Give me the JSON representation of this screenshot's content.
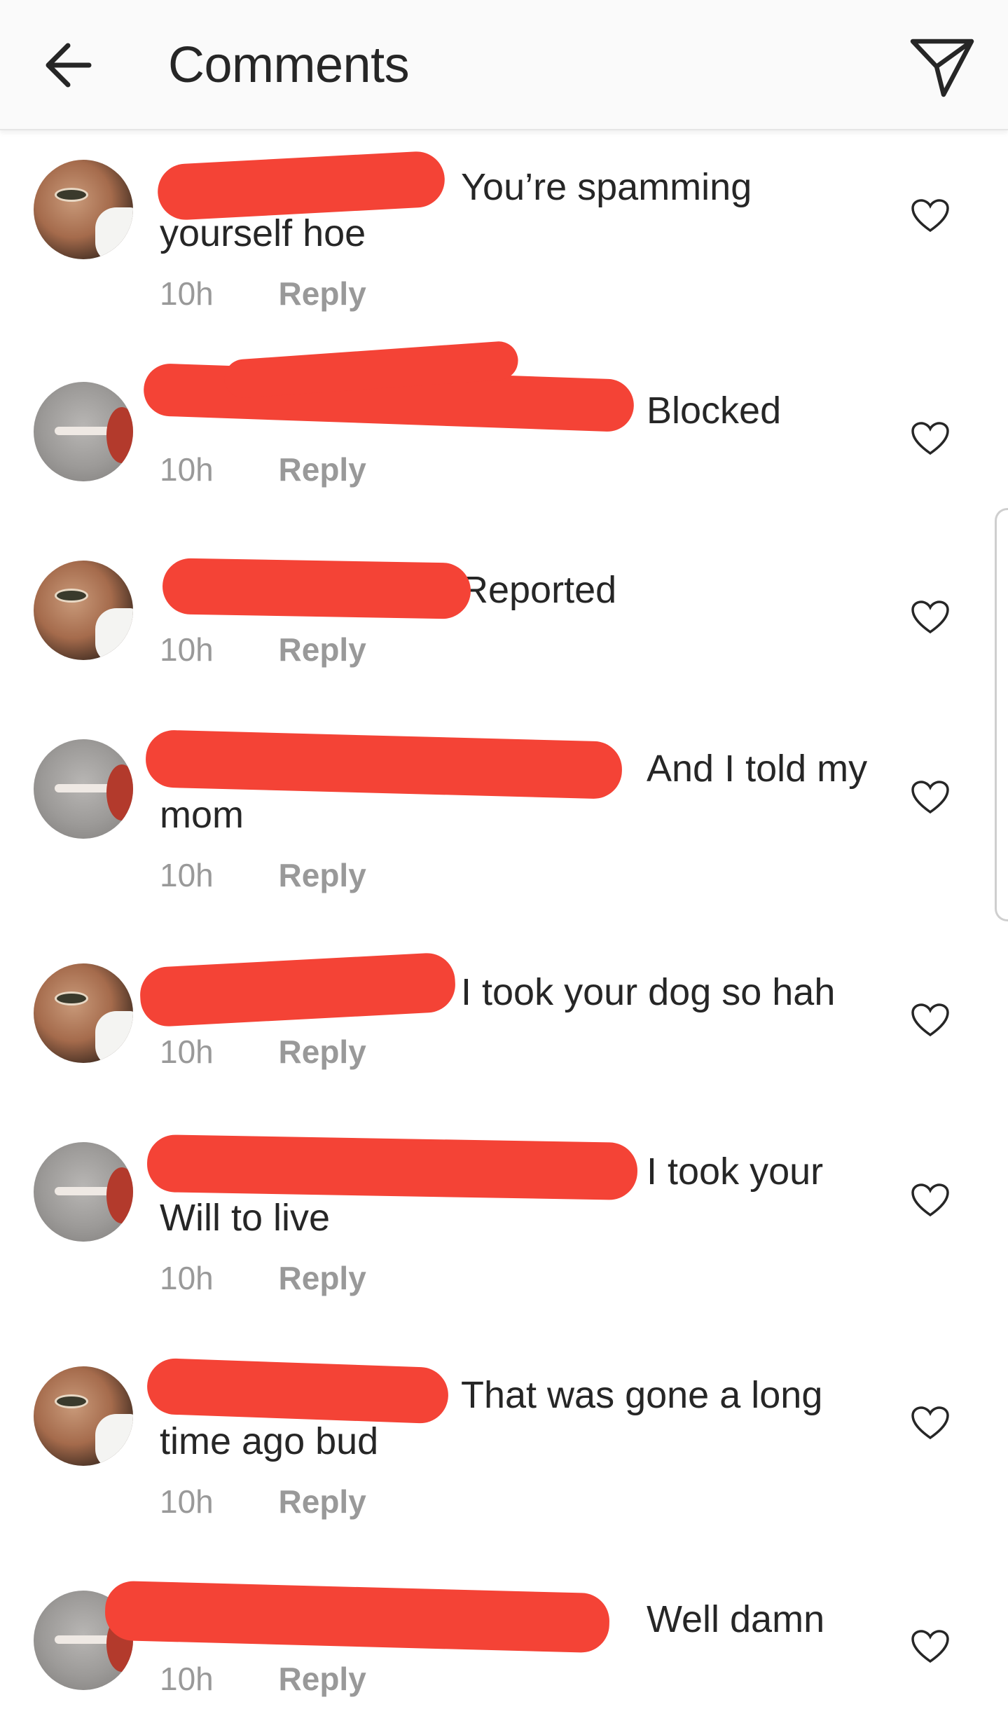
{
  "header": {
    "title": "Comments",
    "back_icon": "arrow-left-icon",
    "share_icon": "paper-plane-icon"
  },
  "comments": [
    {
      "text": "You’re spamming yourself hoe",
      "time": "10h",
      "reply": "Reply",
      "avatar": "face"
    },
    {
      "text": "Blocked",
      "time": "10h",
      "reply": "Reply",
      "avatar": "grey"
    },
    {
      "text": "Reported",
      "time": "10h",
      "reply": "Reply",
      "avatar": "face"
    },
    {
      "text": "And I told my mom",
      "time": "10h",
      "reply": "Reply",
      "avatar": "grey"
    },
    {
      "text": "I took your dog so hah",
      "time": "10h",
      "reply": "Reply",
      "avatar": "face"
    },
    {
      "text": "I took your Will to live",
      "time": "10h",
      "reply": "Reply",
      "avatar": "grey"
    },
    {
      "text": "That was gone a long time ago bud",
      "time": "10h",
      "reply": "Reply",
      "avatar": "face"
    },
    {
      "text": "Well damn",
      "time": "10h",
      "reply": "Reply",
      "avatar": "grey"
    }
  ],
  "colors": {
    "text": "#262626",
    "muted": "#999999",
    "header_bg": "#fafafa",
    "redaction": "#f44336"
  }
}
